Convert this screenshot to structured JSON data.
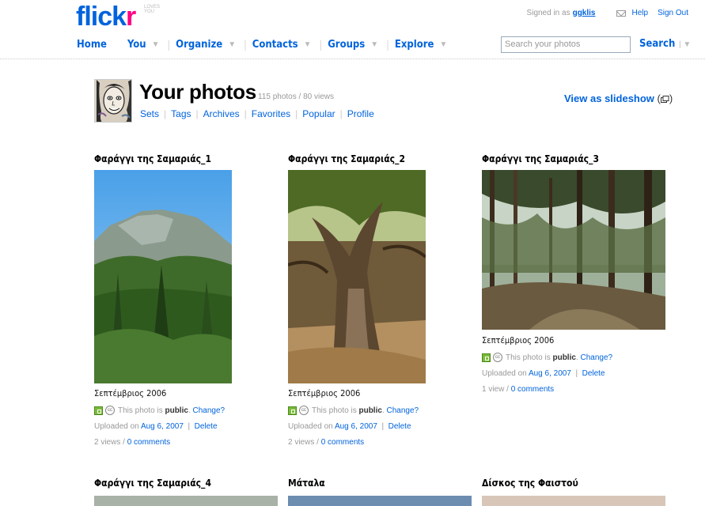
{
  "header": {
    "logo": "flickr",
    "logo_tagline": "LOVES YOU",
    "signed_in_prefix": "Signed in as",
    "username": "ggklis",
    "help": "Help",
    "sign_out": "Sign Out"
  },
  "nav": {
    "items": [
      "Home",
      "You",
      "Organize",
      "Contacts",
      "Groups",
      "Explore"
    ],
    "search_placeholder": "Search your photos",
    "search_button": "Search"
  },
  "page": {
    "title": "Your photos",
    "count": "115 photos / 80 views",
    "subnav": [
      "Sets",
      "Tags",
      "Archives",
      "Favorites",
      "Popular",
      "Profile"
    ],
    "slideshow": "View as slideshow"
  },
  "photos": [
    {
      "title": "Φαράγγι της Σαμαριάς_1",
      "date": "Σεπτέμβριος 2006",
      "privacy_prefix": "This photo is",
      "privacy": "public",
      "change": "Change?",
      "uploaded_prefix": "Uploaded on",
      "uploaded": "Aug 6, 2007",
      "delete": "Delete",
      "views": "2 views",
      "comments": "0 comments"
    },
    {
      "title": "Φαράγγι της Σαμαριάς_2",
      "date": "Σεπτέμβριος 2006",
      "privacy_prefix": "This photo is",
      "privacy": "public",
      "change": "Change?",
      "uploaded_prefix": "Uploaded on",
      "uploaded": "Aug 6, 2007",
      "delete": "Delete",
      "views": "2 views",
      "comments": "0 comments"
    },
    {
      "title": "Φαράγγι της Σαμαριάς_3",
      "date": "Σεπτέμβριος 2006",
      "privacy_prefix": "This photo is",
      "privacy": "public",
      "change": "Change?",
      "uploaded_prefix": "Uploaded on",
      "uploaded": "Aug 6, 2007",
      "delete": "Delete",
      "views": "1 view",
      "comments": "0 comments"
    },
    {
      "title": "Φαράγγι της Σαμαριάς_4"
    },
    {
      "title": "Μάταλα"
    },
    {
      "title": "Δίσκος της Φαιστού"
    }
  ]
}
